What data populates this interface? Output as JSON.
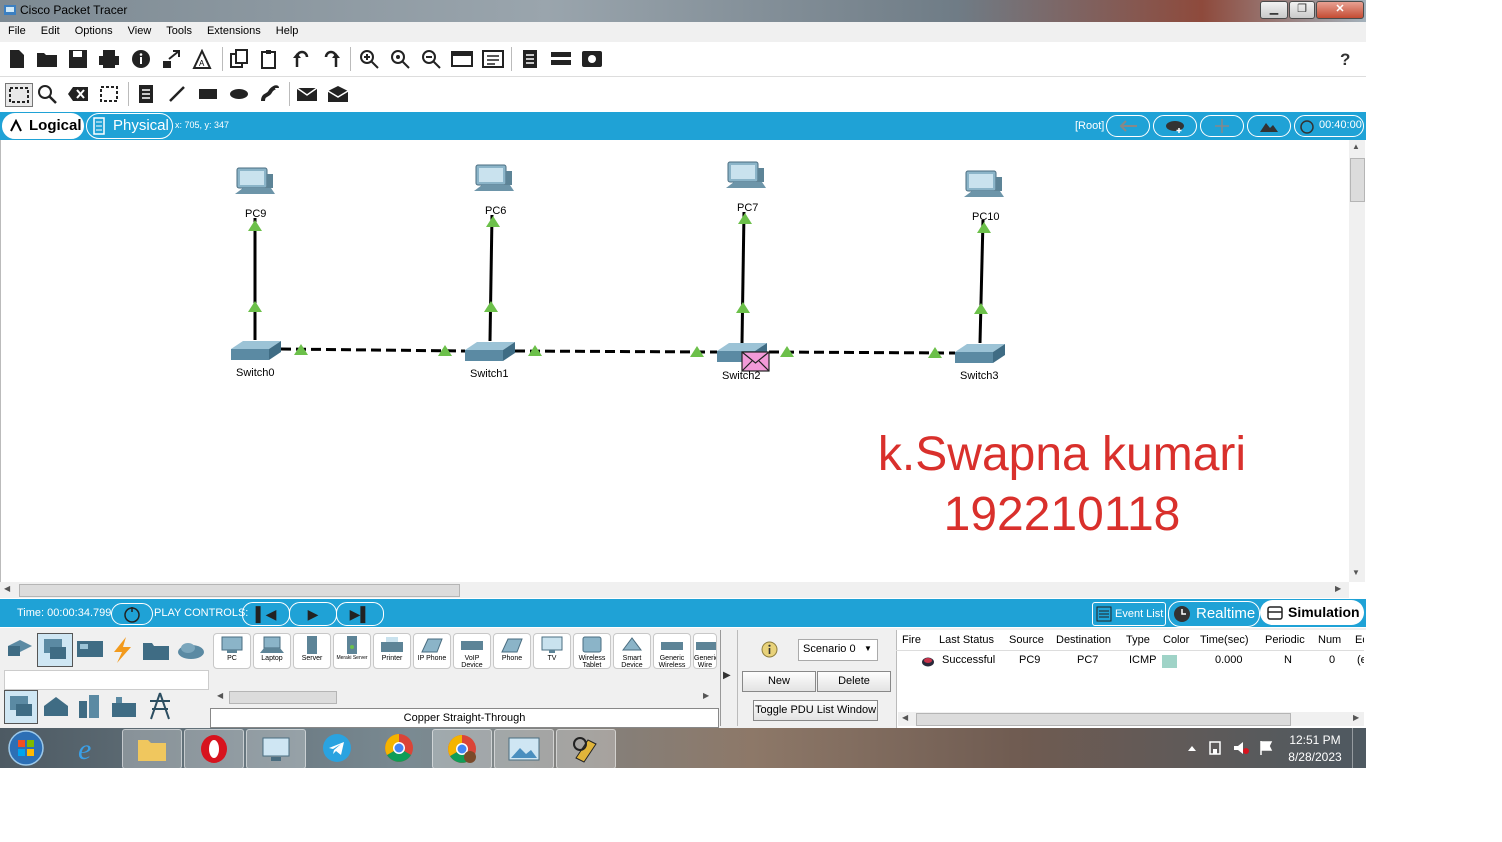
{
  "window": {
    "title": "Cisco Packet Tracer"
  },
  "menu": [
    "File",
    "Edit",
    "Options",
    "View",
    "Tools",
    "Extensions",
    "Help"
  ],
  "toolbar": {
    "help": "?"
  },
  "workspace_bar": {
    "logical_tab": "Logical",
    "physical_tab": "Physical",
    "coords": "x: 705, y: 347",
    "root_label": "[Root]",
    "time_display": "00:40:00"
  },
  "topology": {
    "pcs": [
      "PC9",
      "PC6",
      "PC7",
      "PC10"
    ],
    "switches": [
      "Switch0",
      "Switch1",
      "Switch2",
      "Switch3"
    ]
  },
  "annotation": {
    "line1": "k.Swapna kumari",
    "line2": "192210118",
    "color": "#d9302c"
  },
  "sim_bar": {
    "time": "Time: 00:00:34.799",
    "play_controls": "PLAY CONTROLS:",
    "event_list": "Event List",
    "realtime": "Realtime",
    "simulation": "Simulation"
  },
  "device_panel": {
    "devices": [
      "PC",
      "Laptop",
      "Server",
      "Meraki Server",
      "Printer",
      "IP Phone",
      "VoIP Device",
      "Phone",
      "TV",
      "Wireless Tablet",
      "Smart Device",
      "Generic Wireless",
      "Generic Wire"
    ],
    "connection_type": "Copper Straight-Through"
  },
  "pdu_panel": {
    "scenario": "Scenario 0",
    "new_button": "New",
    "delete_button": "Delete",
    "toggle_button": "Toggle PDU List Window",
    "columns": [
      "Fire",
      "Last Status",
      "Source",
      "Destination",
      "Type",
      "Color",
      "Time(sec)",
      "Periodic",
      "Num",
      "Ed"
    ],
    "row": {
      "status": "Successful",
      "source": "PC9",
      "destination": "PC7",
      "type": "ICMP",
      "color": "#9fd3c7",
      "time": "0.000",
      "periodic": "N",
      "num": "0",
      "edit": "(e"
    }
  },
  "taskbar": {
    "time": "12:51 PM",
    "date": "8/28/2023"
  },
  "colors": {
    "accent": "#1fa2d6",
    "link_light": "#6cc04a"
  }
}
